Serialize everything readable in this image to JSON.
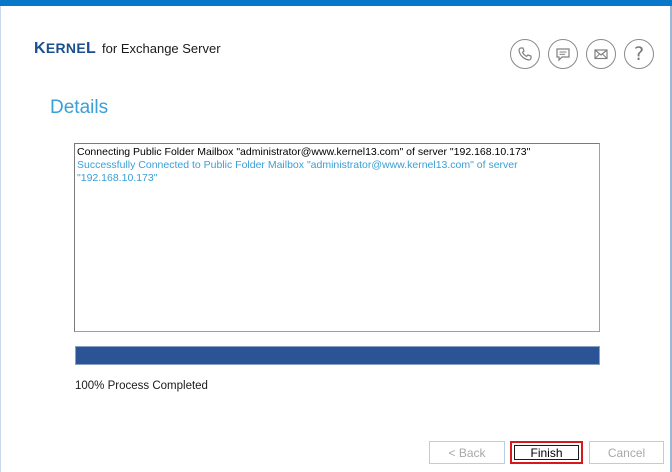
{
  "header": {
    "brand": "KERNEL",
    "product": "for Exchange Server"
  },
  "support_icons": [
    "phone-icon",
    "chat-icon",
    "mail-icon",
    "help-icon"
  ],
  "help_glyph": "?",
  "page": {
    "title": "Details"
  },
  "log": {
    "lines": [
      "Connecting Public Folder Mailbox \"administrator@www.kernel13.com\" of server \"192.168.10.173\"",
      "Successfully Connected to Public Folder Mailbox \"administrator@www.kernel13.com\" of server \"192.168.10.173\""
    ]
  },
  "progress": {
    "value_percent": 100,
    "status_text": "100% Process Completed"
  },
  "buttons": {
    "back_label": "< Back",
    "finish_label": "Finish",
    "cancel_label": "Cancel"
  },
  "colors": {
    "accent": "#0a78c8",
    "title": "#3a9fd6",
    "progress_fill": "#2a5496",
    "success_text": "#3a9fd6",
    "focus_border": "#d8191c"
  }
}
